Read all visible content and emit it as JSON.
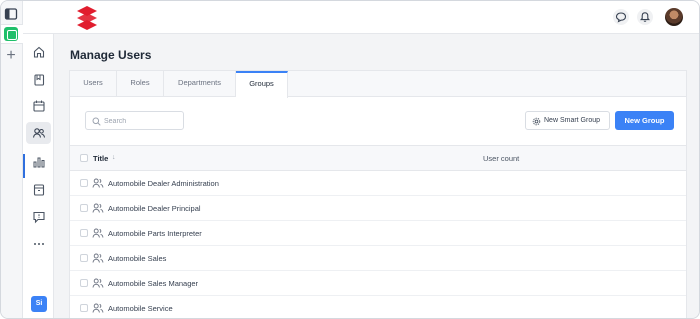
{
  "brand": {
    "accent": "#3b82f6",
    "logo_color": "#e11d2e",
    "logo_name": "suzuki-logo"
  },
  "header": {
    "chat_icon": "chat-bubble-icon",
    "bell_icon": "bell-icon"
  },
  "nav": {
    "items": [
      "home-icon",
      "book-icon",
      "calendar-icon",
      "users-icon",
      "bar-chart-icon",
      "archive-icon",
      "message-icon",
      "more-icon"
    ],
    "active": "users-icon",
    "user_initials": "Si"
  },
  "page": {
    "title": "Manage Users"
  },
  "tabs": [
    {
      "label": "Users"
    },
    {
      "label": "Roles"
    },
    {
      "label": "Departments"
    },
    {
      "label": "Groups"
    }
  ],
  "active_tab": "Groups",
  "toolbar": {
    "search_placeholder": "Search",
    "smart_group_label": "New Smart Group",
    "new_group_label": "New Group"
  },
  "table": {
    "columns": {
      "title": "Title",
      "sort_indicator": "↓",
      "user_count": "User count"
    },
    "rows": [
      {
        "name": "Automobile Dealer Administration",
        "user_count": ""
      },
      {
        "name": "Automobile Dealer Principal",
        "user_count": ""
      },
      {
        "name": "Automobile Parts Interpreter",
        "user_count": ""
      },
      {
        "name": "Automobile Sales",
        "user_count": ""
      },
      {
        "name": "Automobile Sales Manager",
        "user_count": ""
      },
      {
        "name": "Automobile Service",
        "user_count": ""
      }
    ]
  }
}
